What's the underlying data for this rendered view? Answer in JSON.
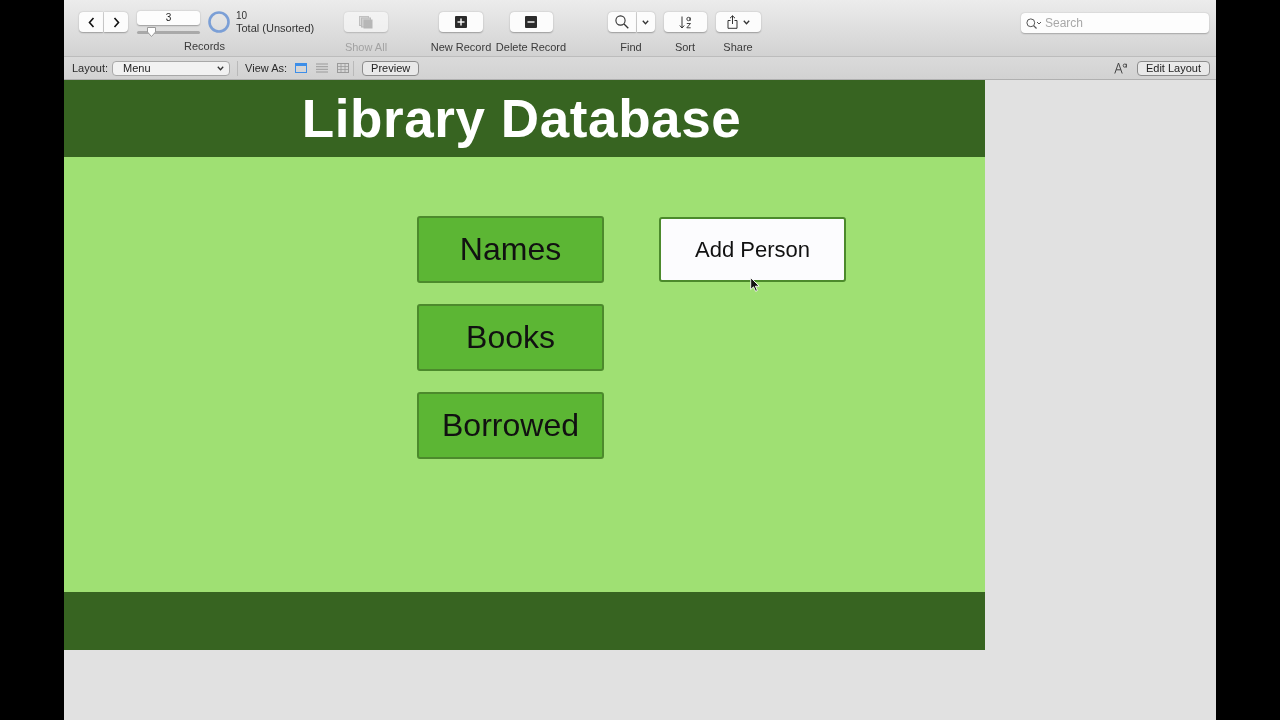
{
  "toolbar": {
    "records": {
      "current": "3",
      "level": 0.22,
      "found": "10",
      "status": "Total (Unsorted)",
      "label": "Records"
    },
    "items": [
      {
        "kind": "show_all",
        "label": "Show All",
        "disabled": true
      },
      {
        "kind": "new_record",
        "label": "New Record",
        "disabled": false
      },
      {
        "kind": "delete_record",
        "label": "Delete Record",
        "disabled": false
      },
      {
        "kind": "find",
        "label": "Find",
        "disabled": false
      },
      {
        "kind": "sort",
        "label": "Sort",
        "disabled": false
      },
      {
        "kind": "share",
        "label": "Share",
        "disabled": false
      }
    ],
    "search": {
      "placeholder": "Search"
    }
  },
  "layout_bar": {
    "layout_label": "Layout:",
    "layout_value": "Menu",
    "view_as_label": "View As:",
    "view_options": [
      {
        "kind": "form",
        "selected": true
      },
      {
        "kind": "list",
        "selected": false
      },
      {
        "kind": "table",
        "selected": false
      }
    ],
    "preview": "Preview",
    "edit_layout": "Edit Layout"
  },
  "layout": {
    "title": "Library Database",
    "menu_buttons": [
      {
        "label": "Names",
        "hovered": false
      },
      {
        "label": "Books",
        "hovered": false
      },
      {
        "label": "Borrowed",
        "hovered": false
      }
    ],
    "action_buttons": [
      {
        "label": "Add Person",
        "hovered": true
      }
    ]
  }
}
